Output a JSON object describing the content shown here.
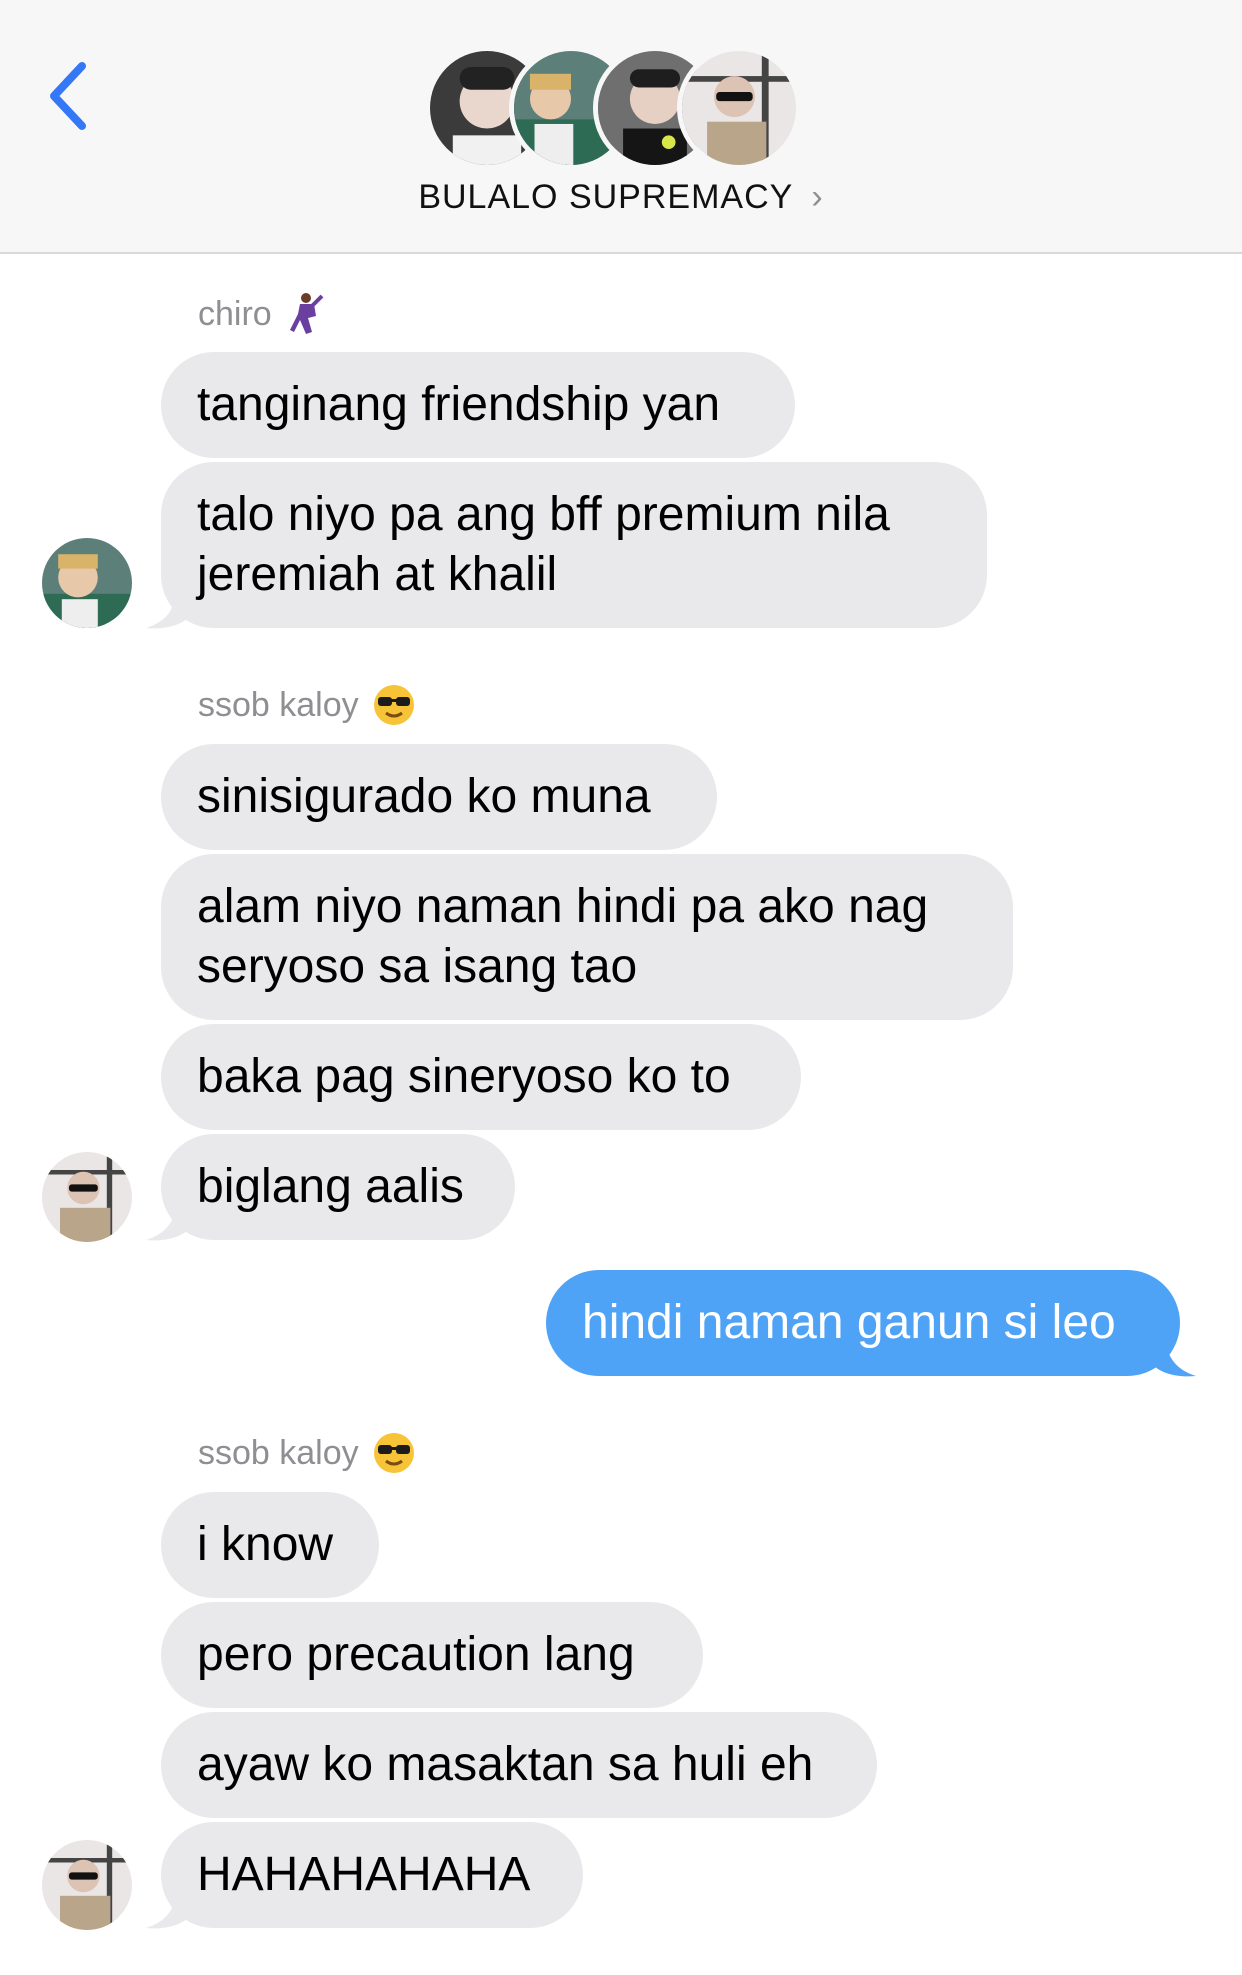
{
  "header": {
    "title": "BULALO SUPREMACY",
    "back_icon": "chevron-left-icon",
    "accent": "#3478f6"
  },
  "messages": {
    "chiro": {
      "name": "chiro",
      "name_emoji_icon": "dancing-man-emoji",
      "m1": "tanginang friendship yan",
      "m2_line1": "talo niyo pa ang bff premium nila",
      "m2_line2": "jeremiah at khalil"
    },
    "kaloy1": {
      "name": "ssob kaloy",
      "name_emoji_icon": "sunglasses-emoji",
      "m1": "sinisigurado ko muna",
      "m2_line1": "alam niyo naman hindi pa ako nag",
      "m2_line2": "seryoso sa isang tao",
      "m3": "baka pag sineryoso ko to",
      "m4": "biglang aalis"
    },
    "me": {
      "m1": "hindi naman ganun si leo",
      "color": "#4fa3f7"
    },
    "kaloy2": {
      "name": "ssob kaloy",
      "name_emoji_icon": "sunglasses-emoji",
      "m1": "i know",
      "m2": "pero precaution lang",
      "m3": "ayaw ko masaktan sa huli eh",
      "m4": "HAHAHAHAHA"
    }
  }
}
